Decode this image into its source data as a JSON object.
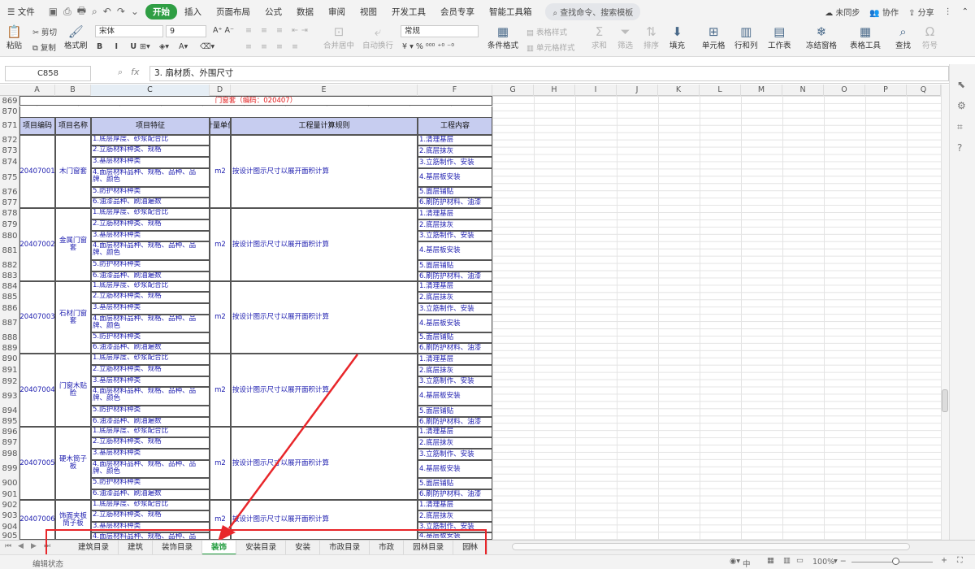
{
  "menubar": {
    "items": [
      "文件",
      "开始",
      "插入",
      "页面布局",
      "公式",
      "数据",
      "审阅",
      "视图",
      "开发工具",
      "会员专享",
      "智能工具箱"
    ],
    "active": "开始",
    "search": "查找命令、搜索模板",
    "sync": "未同步",
    "collab": "协作",
    "share": "分享"
  },
  "ribbon": {
    "paste": "粘贴",
    "cut": "剪切",
    "copy": "复制",
    "format_painter": "格式刷",
    "font": "宋体",
    "size": "9",
    "merge": "合并居中",
    "wrap": "自动换行",
    "numfmt": "常规",
    "cond_format": "条件格式",
    "table_style": "表格样式",
    "cell_style": "单元格样式",
    "sum": "求和",
    "filter": "筛选",
    "sort": "排序",
    "fill": "填充",
    "cell": "单元格",
    "rowcol": "行和列",
    "sheet": "工作表",
    "freeze": "冻结窗格",
    "table_tools": "表格工具",
    "find": "查找",
    "symbol": "符号"
  },
  "formula": {
    "cell_ref": "C858",
    "fx": "fx",
    "content": "3. 扇材质、外围尺寸"
  },
  "columns": [
    "A",
    "B",
    "C",
    "D",
    "E",
    "F",
    "G",
    "H",
    "I",
    "J",
    "K",
    "L",
    "M",
    "N",
    "O",
    "P",
    "Q"
  ],
  "rows": [
    "869",
    "870",
    "871",
    "872",
    "873",
    "874",
    "875",
    "876",
    "877",
    "878",
    "879",
    "880",
    "881",
    "882",
    "883",
    "884",
    "885",
    "886",
    "887",
    "888",
    "889",
    "890",
    "891",
    "892",
    "893",
    "894",
    "895",
    "896",
    "897",
    "898",
    "899",
    "900",
    "901",
    "902",
    "903",
    "904",
    "905"
  ],
  "table": {
    "title": "门窗套（编码：020407）",
    "headers": {
      "code": "项目编码",
      "name": "项目名称",
      "feature": "项目特征",
      "unit": "计量单位",
      "rule": "工程量计算规则",
      "work": "工程内容"
    },
    "features": [
      "1.底层厚度、砂浆配合比",
      "2.立筋材料种类、规格",
      "3.基层材料种类",
      "4.面层材料品种、规格、品种、品牌、颜色",
      "5.防护材料种类",
      "6.油漆品种、刷油遍数"
    ],
    "works": [
      "1.清理基层",
      "2.底层抹灰",
      "3.立筋制作、安装",
      "4.基层板安装",
      "5.面层铺贴",
      "6.刷防护材料、油漆"
    ],
    "unit": "m2",
    "rule": "按设计图示尺寸以展开面积计算",
    "items": [
      {
        "code": "20407001",
        "name": "木门窗套"
      },
      {
        "code": "20407002",
        "name": "金属门窗套"
      },
      {
        "code": "20407003",
        "name": "石材门窗套"
      },
      {
        "code": "20407004",
        "name": "门窗木贴脸"
      },
      {
        "code": "20407005",
        "name": "硬木筒子板"
      },
      {
        "code": "20407006",
        "name": "饰面夹板筒子板"
      }
    ]
  },
  "sheets": [
    "建筑目录",
    "建筑",
    "装饰目录",
    "装饰",
    "安装目录",
    "安装",
    "市政目录",
    "市政",
    "园林目录",
    "园林"
  ],
  "active_sheet": "装饰",
  "status": {
    "mode": "编辑状态",
    "zoom": "100%",
    "lang": "中"
  },
  "colors": {
    "accent": "#2f9e44",
    "header_bg": "#c7cdf0",
    "text_blue": "#2020b0",
    "title_red": "#e21b1b",
    "annotation": "#e8262a"
  }
}
